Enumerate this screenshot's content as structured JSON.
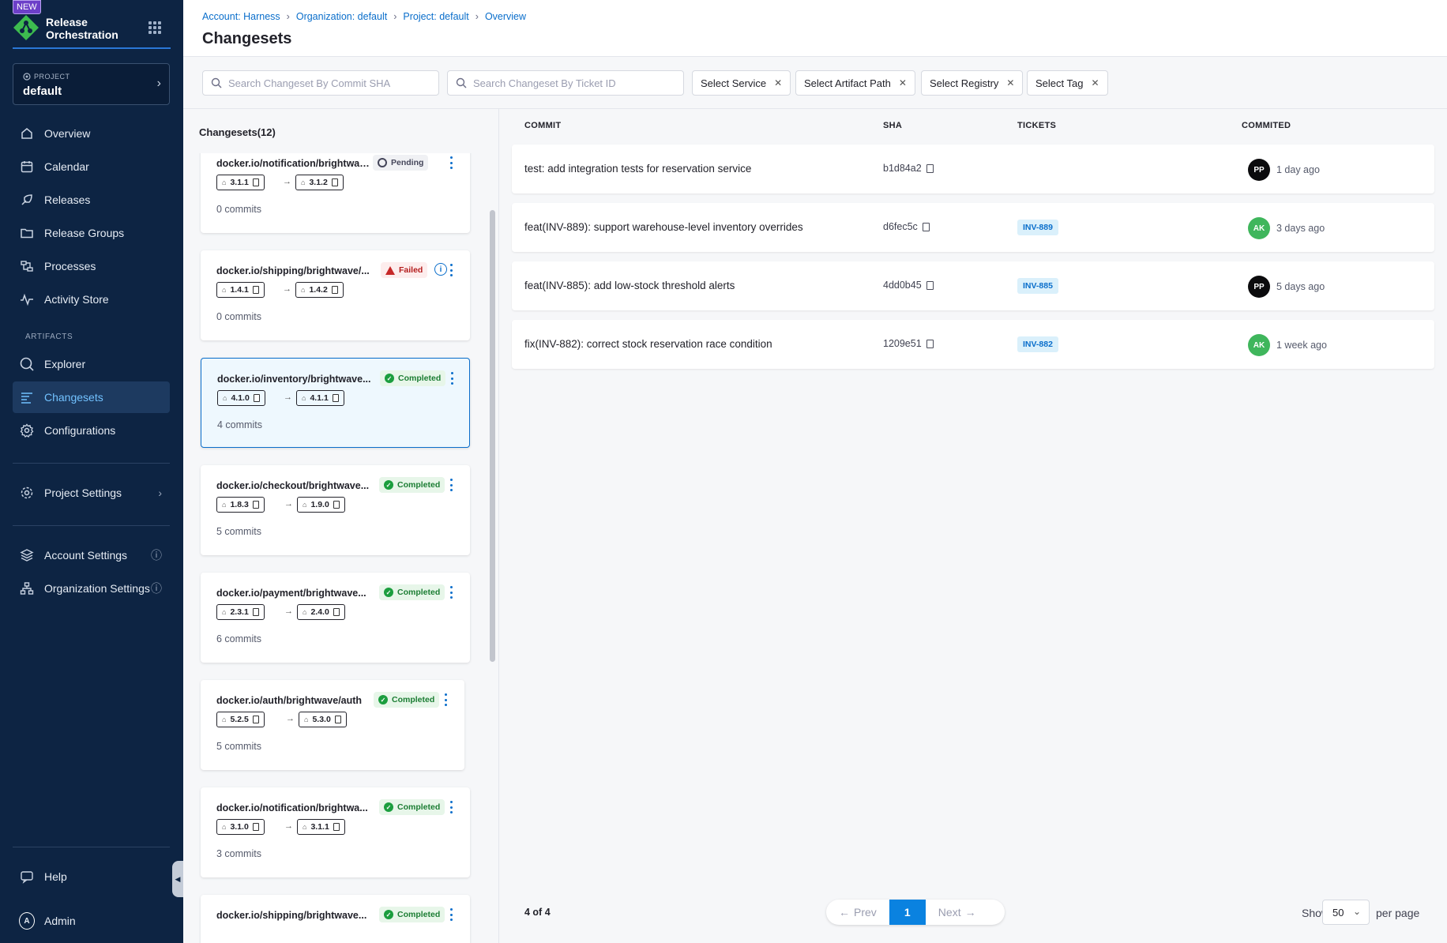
{
  "sidebar": {
    "new_badge": "NEW",
    "module_title_line1": "Release",
    "module_title_line2": "Orchestration",
    "project_label": "PROJECT",
    "project_value": "default",
    "nav": [
      {
        "label": "Overview",
        "icon": "home-icon"
      },
      {
        "label": "Calendar",
        "icon": "calendar-icon"
      },
      {
        "label": "Releases",
        "icon": "releases-icon"
      },
      {
        "label": "Release Groups",
        "icon": "folder-icon"
      },
      {
        "label": "Processes",
        "icon": "processes-icon"
      },
      {
        "label": "Activity Store",
        "icon": "activity-icon"
      }
    ],
    "artifacts_label": "ARTIFACTS",
    "artifacts_nav": [
      {
        "label": "Explorer",
        "icon": "search-icon"
      },
      {
        "label": "Changesets",
        "icon": "changesets-icon",
        "active": true
      },
      {
        "label": "Configurations",
        "icon": "gear-icon"
      }
    ],
    "project_settings": "Project Settings",
    "account_settings": "Account Settings",
    "organization_settings": "Organization Settings",
    "help": "Help",
    "user": "Admin",
    "user_initial": "A"
  },
  "header": {
    "breadcrumbs": [
      "Account: Harness",
      "Organization: default",
      "Project: default",
      "Overview"
    ],
    "title": "Changesets"
  },
  "filters": {
    "commit_sha_placeholder": "Search Changeset By Commit SHA",
    "ticket_placeholder": "Search Changeset By Ticket ID",
    "chips": [
      "Select Service",
      "Select Artifact Path",
      "Select Registry",
      "Select Tag"
    ]
  },
  "changesets": {
    "count_label": "Changesets(12)",
    "items": [
      {
        "name": "docker.io/notification/brightwave...",
        "status": "Pending",
        "from": "3.1.1",
        "to": "3.1.2",
        "commits": "0 commits"
      },
      {
        "name": "docker.io/shipping/brightwave/...",
        "status": "Failed",
        "from": "1.4.1",
        "to": "1.4.2",
        "commits": "0 commits"
      },
      {
        "name": "docker.io/inventory/brightwave...",
        "status": "Completed",
        "from": "4.1.0",
        "to": "4.1.1",
        "commits": "4 commits"
      },
      {
        "name": "docker.io/checkout/brightwave...",
        "status": "Completed",
        "from": "1.8.3",
        "to": "1.9.0",
        "commits": "5 commits"
      },
      {
        "name": "docker.io/payment/brightwave...",
        "status": "Completed",
        "from": "2.3.1",
        "to": "2.4.0",
        "commits": "6 commits"
      },
      {
        "name": "docker.io/auth/brightwave/auth",
        "status": "Completed",
        "from": "5.2.5",
        "to": "5.3.0",
        "commits": "5 commits"
      },
      {
        "name": "docker.io/notification/brightwa...",
        "status": "Completed",
        "from": "3.1.0",
        "to": "3.1.1",
        "commits": "3 commits"
      },
      {
        "name": "docker.io/shipping/brightwave...",
        "status": "Completed",
        "from": "",
        "to": "",
        "commits": ""
      }
    ]
  },
  "commits_table": {
    "headers": [
      "COMMIT",
      "SHA",
      "TICKETS",
      "COMMITED"
    ],
    "rows": [
      {
        "message": "test: add integration tests for reservation service",
        "sha": "b1d84a2",
        "ticket": "",
        "author": "PP",
        "author_color": "#0b0b0d",
        "time": "1 day ago"
      },
      {
        "message": "feat(INV-889): support warehouse-level inventory overrides",
        "sha": "d6fec5c",
        "ticket": "INV-889",
        "author": "AK",
        "author_color": "#3fb65c",
        "time": "3 days ago"
      },
      {
        "message": "feat(INV-885): add low-stock threshold alerts",
        "sha": "4dd0b45",
        "ticket": "INV-885",
        "author": "PP",
        "author_color": "#0b0b0d",
        "time": "5 days ago"
      },
      {
        "message": "fix(INV-882): correct stock reservation race condition",
        "sha": "1209e51",
        "ticket": "INV-882",
        "author": "AK",
        "author_color": "#3fb65c",
        "time": "1 week ago"
      }
    ]
  },
  "pagination": {
    "count": "4 of 4",
    "prev": "Prev",
    "page": "1",
    "next": "Next",
    "show": "Show",
    "per_page_value": "50",
    "per_page_label": "per page"
  },
  "colors": {
    "sidebar_bg": "#0d2443",
    "accent": "#0a6ecb",
    "completed": "#1b9e3e",
    "failed": "#c62828"
  }
}
